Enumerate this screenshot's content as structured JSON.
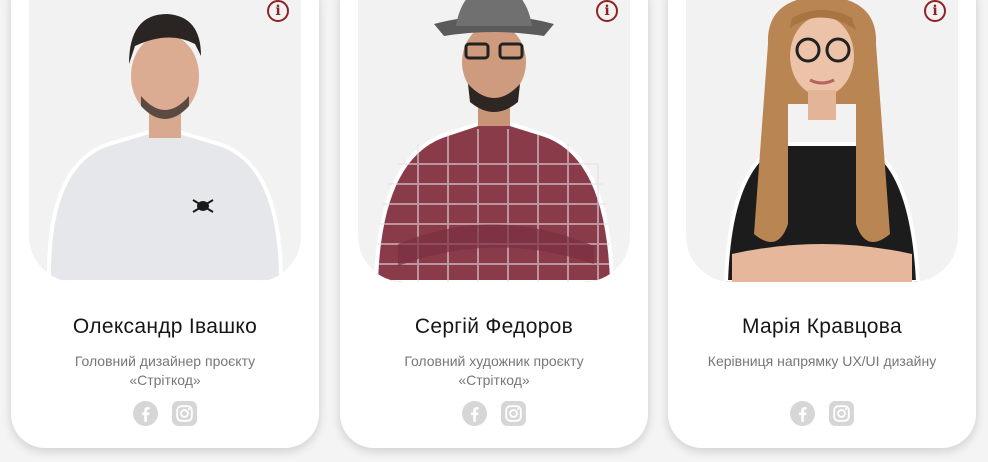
{
  "info_symbol": "i",
  "team": [
    {
      "name": "Олександр Івашко",
      "role": "Головний дизайнер проєкту «Стріткод»",
      "photo_icon": "person-photo-icon"
    },
    {
      "name": "Сергій Федоров",
      "role": "Головний художник проєкту «Стріткод»",
      "photo_icon": "person-photo-icon"
    },
    {
      "name": "Марія Кравцова",
      "role": "Керівниця напрямку UX/UI дизайну",
      "photo_icon": "person-photo-icon"
    }
  ],
  "social_icons": [
    "facebook-icon",
    "instagram-icon"
  ],
  "colors": {
    "accent": "#8f2222",
    "card_bg": "#ffffff",
    "page_bg": "#f4f4f4",
    "text": "#161616",
    "muted": "#777777",
    "social_icon": "#d6d6d6"
  }
}
